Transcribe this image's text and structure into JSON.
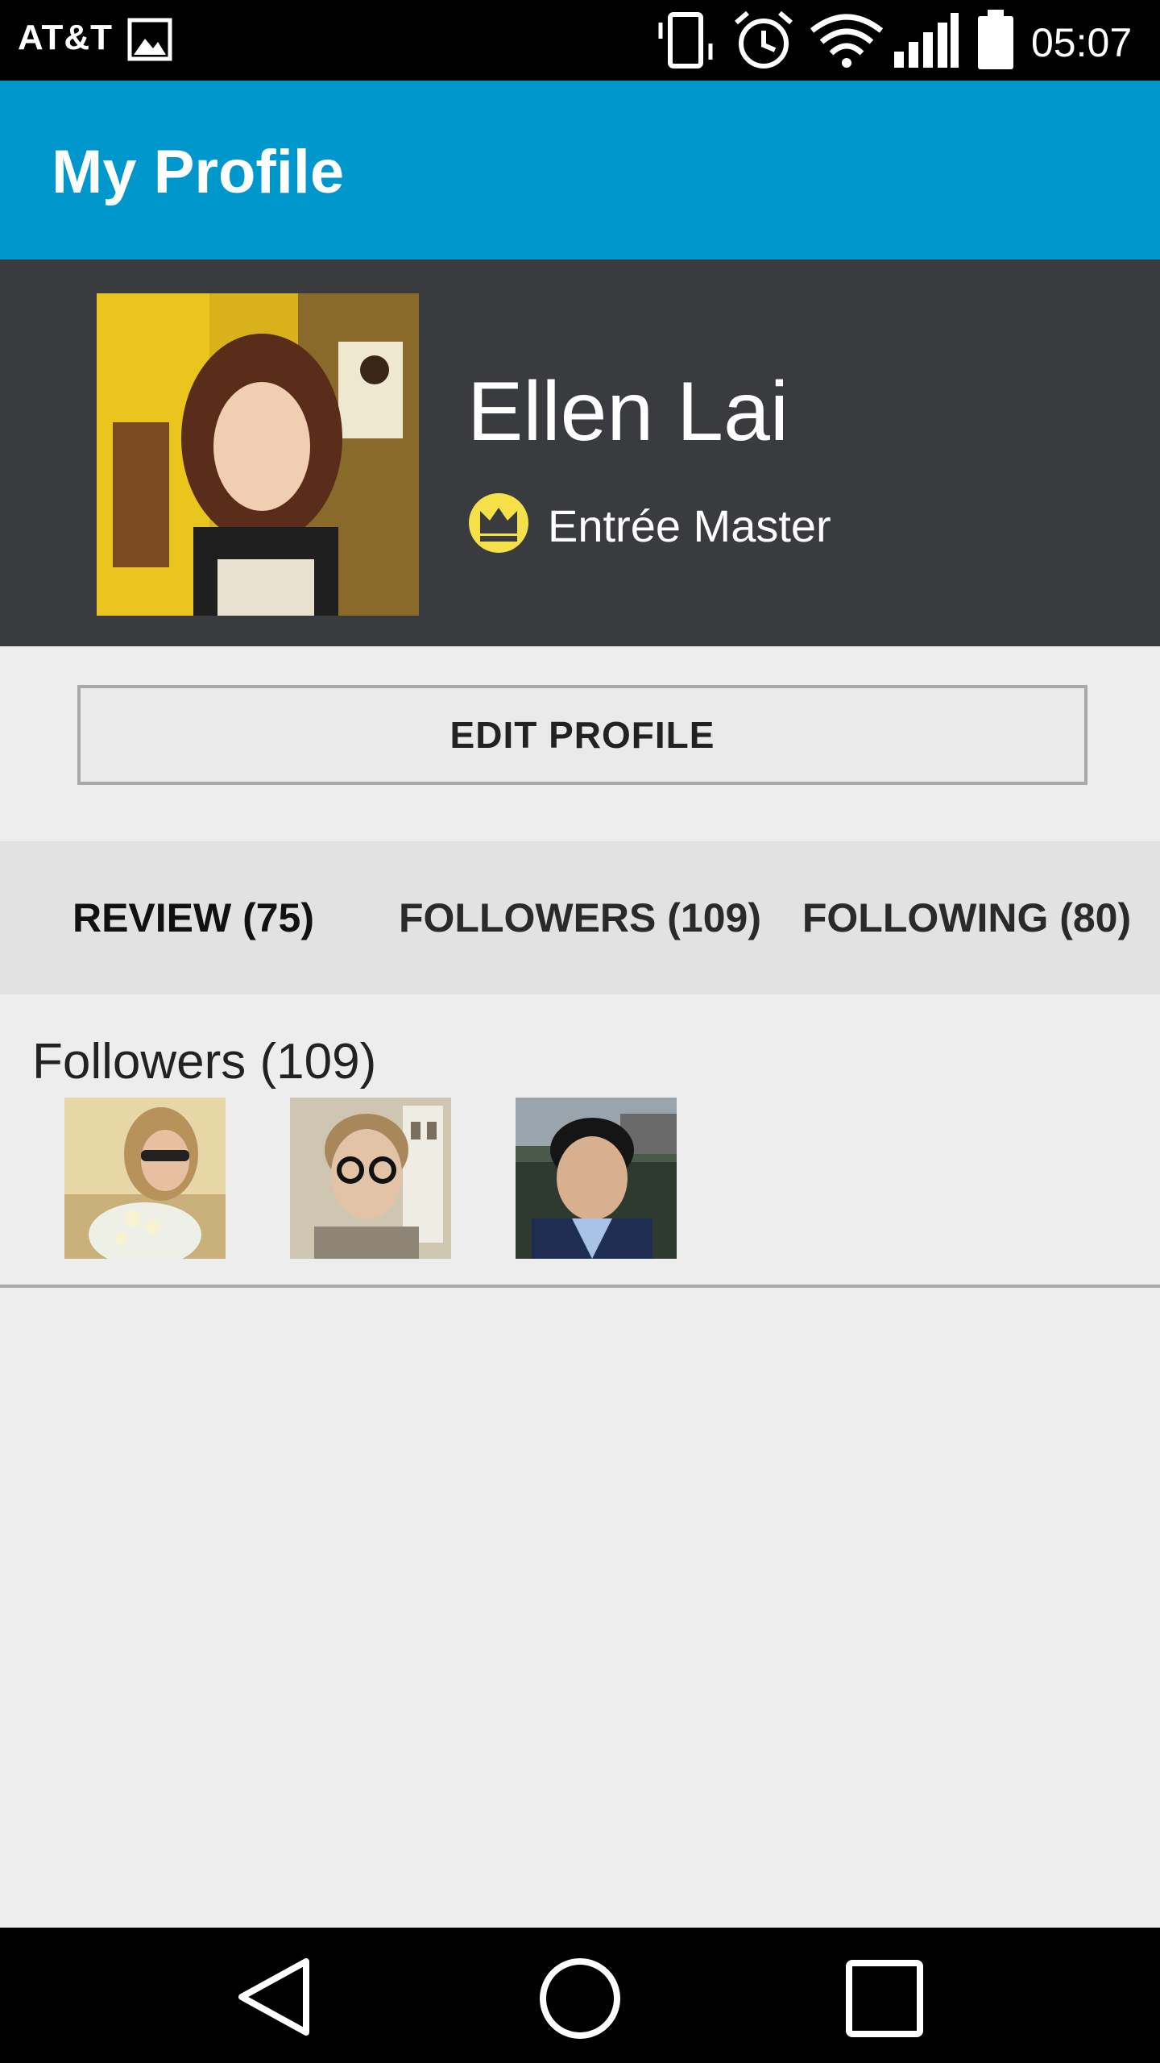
{
  "status_bar": {
    "carrier": "AT&T",
    "time": "05:07",
    "icons": [
      "image-icon",
      "vibrate-icon",
      "alarm-icon",
      "wifi-icon",
      "signal-icon",
      "battery-icon"
    ]
  },
  "app_bar": {
    "title": "My Profile",
    "color": "#0097cc"
  },
  "profile": {
    "name": "Ellen Lai",
    "rank": "Entrée Master",
    "badge_icon": "crown-icon",
    "badge_color": "#f5e04a",
    "header_color": "#3a3b3f"
  },
  "actions": {
    "edit_profile": "EDIT PROFILE"
  },
  "tabs": [
    {
      "label": "REVIEW (75)"
    },
    {
      "label": "FOLLOWERS (109)"
    },
    {
      "label": "FOLLOWING (80)"
    }
  ],
  "followers_section": {
    "heading": "Followers (109)",
    "avatars": [
      "follower-avatar-1",
      "follower-avatar-2",
      "follower-avatar-3"
    ]
  },
  "nav_bar": {
    "icons": [
      "back-icon",
      "home-icon",
      "recents-icon"
    ]
  }
}
